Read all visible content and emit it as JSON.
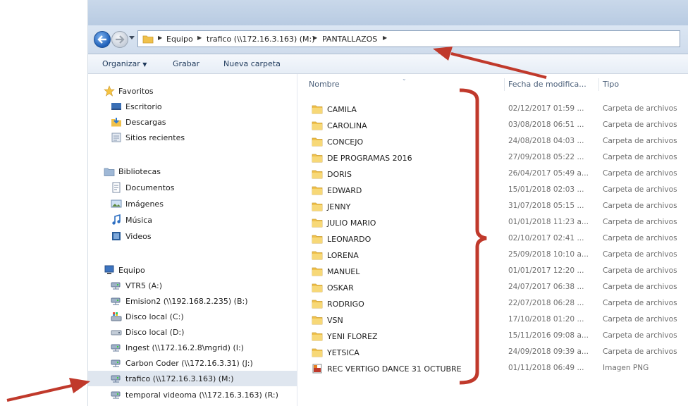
{
  "address": {
    "crumbs": [
      "Equipo",
      "trafico (\\\\172.16.3.163) (M:)",
      "PANTALLAZOS"
    ]
  },
  "toolbar": {
    "organize_label": "Organizar",
    "burn_label": "Grabar",
    "new_folder_label": "Nueva carpeta"
  },
  "navpane": {
    "favorites": {
      "label": "Favoritos",
      "items": [
        {
          "label": "Escritorio",
          "icon": "desktop-icon"
        },
        {
          "label": "Descargas",
          "icon": "downloads-icon"
        },
        {
          "label": "Sitios recientes",
          "icon": "recent-places-icon"
        }
      ]
    },
    "libraries": {
      "label": "Bibliotecas",
      "items": [
        {
          "label": "Documentos",
          "icon": "documents-icon"
        },
        {
          "label": "Imágenes",
          "icon": "pictures-icon"
        },
        {
          "label": "Música",
          "icon": "music-icon"
        },
        {
          "label": "Videos",
          "icon": "videos-icon"
        }
      ]
    },
    "computer": {
      "label": "Equipo",
      "items": [
        {
          "label": "VTR5 (A:)",
          "icon": "network-drive-icon"
        },
        {
          "label": "Emision2 (\\\\192.168.2.235) (B:)",
          "icon": "network-drive-icon"
        },
        {
          "label": "Disco local (C:)",
          "icon": "system-drive-icon"
        },
        {
          "label": "Disco local (D:)",
          "icon": "local-drive-icon"
        },
        {
          "label": "Ingest (\\\\172.16.2.8\\mgrid) (I:)",
          "icon": "network-drive-icon"
        },
        {
          "label": "Carbon Coder (\\\\172.16.3.31) (J:)",
          "icon": "network-drive-icon"
        },
        {
          "label": "trafico (\\\\172.16.3.163) (M:)",
          "icon": "network-drive-icon",
          "selected": true
        },
        {
          "label": "temporal videoma (\\\\172.16.3.163) (R:)",
          "icon": "network-drive-icon"
        }
      ]
    }
  },
  "columns": {
    "name": "Nombre",
    "date": "Fecha de modifica...",
    "type": "Tipo"
  },
  "files": [
    {
      "name": "CAMILA",
      "date": "02/12/2017 01:59 ...",
      "type": "Carpeta de archivos",
      "icon": "folder-icon"
    },
    {
      "name": "CAROLINA",
      "date": "03/08/2018 06:51 ...",
      "type": "Carpeta de archivos",
      "icon": "folder-icon"
    },
    {
      "name": "CONCEJO",
      "date": "24/08/2018 04:03 ...",
      "type": "Carpeta de archivos",
      "icon": "folder-icon"
    },
    {
      "name": "DE PROGRAMAS 2016",
      "date": "27/09/2018 05:22 ...",
      "type": "Carpeta de archivos",
      "icon": "folder-icon"
    },
    {
      "name": "DORIS",
      "date": "26/04/2017 05:49 a...",
      "type": "Carpeta de archivos",
      "icon": "folder-icon"
    },
    {
      "name": "EDWARD",
      "date": "15/01/2018 02:03 ...",
      "type": "Carpeta de archivos",
      "icon": "folder-icon"
    },
    {
      "name": "JENNY",
      "date": "31/07/2018 05:15 ...",
      "type": "Carpeta de archivos",
      "icon": "folder-icon"
    },
    {
      "name": "JULIO MARIO",
      "date": "01/01/2018 11:23 a...",
      "type": "Carpeta de archivos",
      "icon": "folder-icon"
    },
    {
      "name": "LEONARDO",
      "date": "02/10/2017 02:41 ...",
      "type": "Carpeta de archivos",
      "icon": "folder-icon"
    },
    {
      "name": "LORENA",
      "date": "25/09/2018 10:10 a...",
      "type": "Carpeta de archivos",
      "icon": "folder-icon"
    },
    {
      "name": "MANUEL",
      "date": "01/01/2017 12:20 ...",
      "type": "Carpeta de archivos",
      "icon": "folder-icon"
    },
    {
      "name": "OSKAR",
      "date": "24/07/2017 06:38 ...",
      "type": "Carpeta de archivos",
      "icon": "folder-icon"
    },
    {
      "name": "RODRIGO",
      "date": "22/07/2018 06:28 ...",
      "type": "Carpeta de archivos",
      "icon": "folder-icon"
    },
    {
      "name": "VSN",
      "date": "17/10/2018 01:20 ...",
      "type": "Carpeta de archivos",
      "icon": "folder-icon"
    },
    {
      "name": "YENI FLOREZ",
      "date": "15/11/2016 09:08 a...",
      "type": "Carpeta de archivos",
      "icon": "folder-icon"
    },
    {
      "name": "YETSICA",
      "date": "24/09/2018 09:39 a...",
      "type": "Carpeta de archivos",
      "icon": "folder-icon"
    },
    {
      "name": "REC VERTIGO DANCE 31 OCTUBRE",
      "date": "01/11/2018 06:49 ...",
      "type": "Imagen PNG",
      "icon": "png-image-icon"
    }
  ],
  "colors": {
    "annotation": "#c0392b",
    "folder": "#f0c14b",
    "selection": "#dfe6ef"
  }
}
